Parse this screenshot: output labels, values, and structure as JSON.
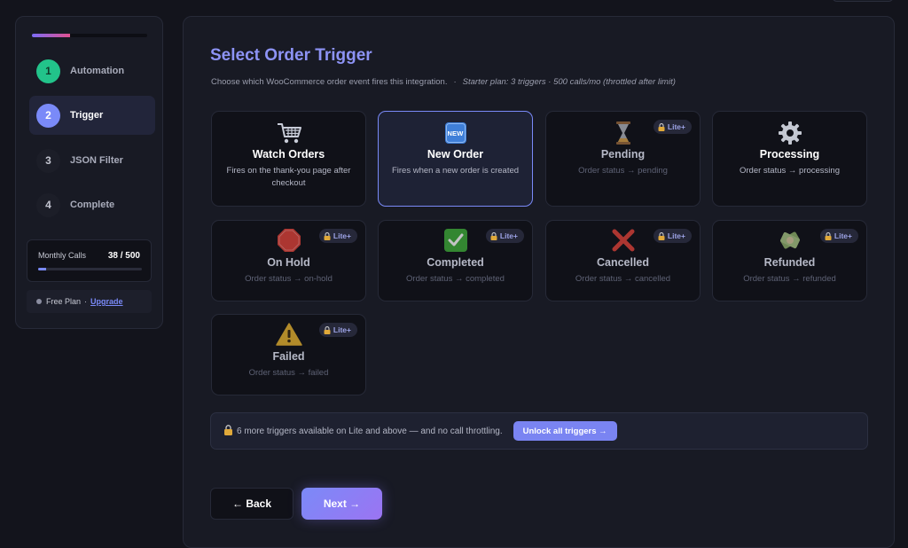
{
  "sidebar": {
    "progress_fraction": 0.33,
    "steps": [
      {
        "number": "1",
        "label": "Automation",
        "state": "done"
      },
      {
        "number": "2",
        "label": "Trigger",
        "state": "current"
      },
      {
        "number": "3",
        "label": "JSON Filter",
        "state": "pending"
      },
      {
        "number": "4",
        "label": "Complete",
        "state": "pending"
      }
    ],
    "calls": {
      "label": "Monthly Calls",
      "value": "38 / 500",
      "used": 38,
      "limit": 500
    },
    "plan": {
      "name": "Free Plan",
      "separator": "·",
      "upgrade_label": "Upgrade"
    }
  },
  "main": {
    "title": "Select Order Trigger",
    "subtitle": "Choose which WooCommerce order event fires this integration.",
    "subtitle_separator": "·",
    "subtitle_plan": "Starter plan: 3 triggers · 500 calls/mo (throttled after limit)",
    "lock_badge": "Lite+",
    "triggers": [
      {
        "icon": "shopping-cart-icon",
        "name": "Watch Orders",
        "desc": "Fires on the thank-you page after checkout",
        "locked": false,
        "selected": false
      },
      {
        "icon": "new-badge-icon",
        "icon_text": "NEW",
        "name": "New Order",
        "desc": "Fires when a new order is created",
        "locked": false,
        "selected": true
      },
      {
        "icon": "hourglass-icon",
        "name": "Pending",
        "desc": "Order status → pending",
        "locked": true,
        "selected": false
      },
      {
        "icon": "gear-icon",
        "name": "Processing",
        "desc": "Order status → processing",
        "locked": false,
        "selected": false
      },
      {
        "icon": "stop-sign-icon",
        "name": "On Hold",
        "desc": "Order status → on-hold",
        "locked": true,
        "selected": false
      },
      {
        "icon": "checkmark-icon",
        "name": "Completed",
        "desc": "Order status → completed",
        "locked": true,
        "selected": false
      },
      {
        "icon": "cross-icon",
        "name": "Cancelled",
        "desc": "Order status → cancelled",
        "locked": true,
        "selected": false
      },
      {
        "icon": "money-refund-icon",
        "name": "Refunded",
        "desc": "Order status → refunded",
        "locked": true,
        "selected": false
      },
      {
        "icon": "warning-icon",
        "name": "Failed",
        "desc": "Order status → failed",
        "locked": true,
        "selected": false
      }
    ],
    "banner": {
      "text": "6 more triggers available on Lite and above — and no call throttling.",
      "button": "Unlock all triggers →"
    },
    "back_label": "← Back",
    "next_label": "Next →"
  },
  "colors": {
    "accent": "#7a8af8",
    "success": "#22c38a",
    "background": "#13141c",
    "panel": "#181a24"
  }
}
